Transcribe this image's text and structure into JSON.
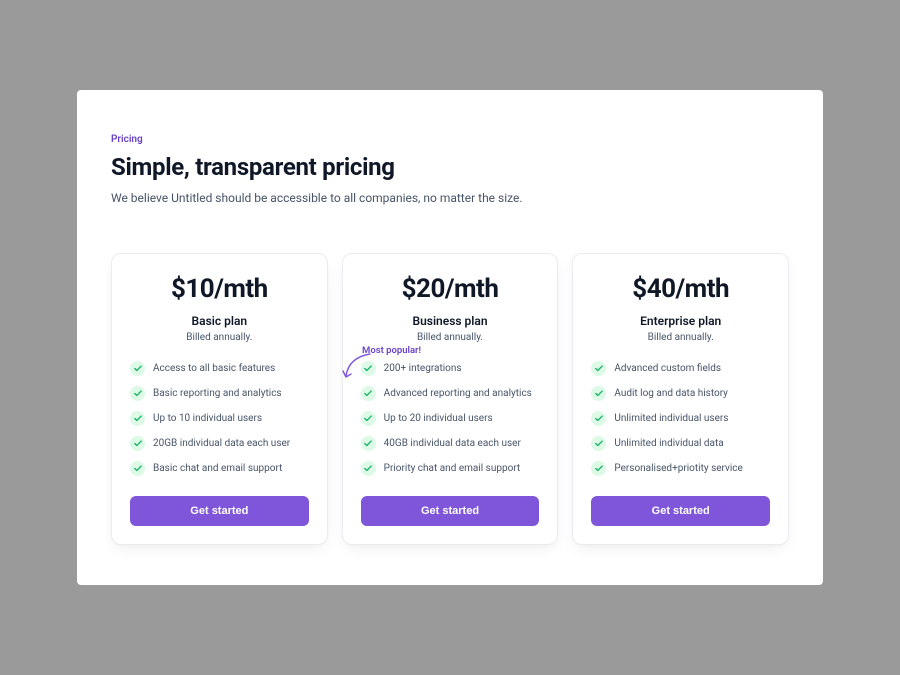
{
  "header": {
    "eyebrow": "Pricing",
    "headline": "Simple, transparent pricing",
    "subheading": "We believe Untitled should be accessible to all companies, no matter the size."
  },
  "callout": {
    "label": "Most popular!"
  },
  "plans": [
    {
      "price": "$10/mth",
      "name": "Basic plan",
      "billing": "Billed annually.",
      "features": [
        "Access to all basic features",
        "Basic reporting and analytics",
        "Up to 10 individual users",
        "20GB individual data each user",
        "Basic chat and email support"
      ],
      "cta": "Get started"
    },
    {
      "price": "$20/mth",
      "name": "Business plan",
      "billing": "Billed annually.",
      "features": [
        "200+ integrations",
        "Advanced reporting and analytics",
        "Up to 20 individual users",
        "40GB individual data each user",
        "Priority chat and email support"
      ],
      "cta": "Get started"
    },
    {
      "price": "$40/mth",
      "name": "Enterprise plan",
      "billing": "Billed annually.",
      "features": [
        "Advanced custom fields",
        "Audit log and data history",
        "Unlimited individual users",
        "Unlimited individual data",
        "Personalised+priotity service"
      ],
      "cta": "Get started"
    }
  ],
  "colors": {
    "accent": "#7F56D9",
    "accentText": "#6941C6",
    "checkBg": "#DCFAE6",
    "checkTick": "#17B26A"
  }
}
